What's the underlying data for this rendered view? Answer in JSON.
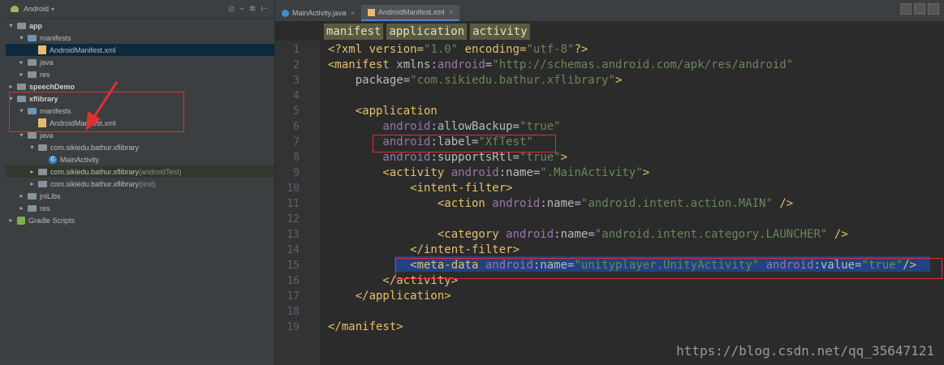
{
  "project": {
    "title": "Android",
    "tree": [
      {
        "label": "app",
        "indent": 0,
        "icon": "folder",
        "bold": true,
        "arrow": "▾"
      },
      {
        "label": "manifests",
        "indent": 1,
        "icon": "folder-blue",
        "arrow": "▾"
      },
      {
        "label": "AndroidManifest.xml",
        "indent": 2,
        "icon": "xml",
        "arrow": "",
        "state": "sel"
      },
      {
        "label": "java",
        "indent": 1,
        "icon": "folder",
        "arrow": "▸"
      },
      {
        "label": "res",
        "indent": 1,
        "icon": "folder",
        "arrow": "▸"
      },
      {
        "label": "speechDemo",
        "indent": 0,
        "icon": "folder",
        "bold": true,
        "arrow": "▸"
      },
      {
        "label": "xflibrary",
        "indent": 0,
        "icon": "folder",
        "bold": true,
        "arrow": "▾"
      },
      {
        "label": "manifests",
        "indent": 1,
        "icon": "folder-blue",
        "arrow": "▾"
      },
      {
        "label": "AndroidManifest.xml",
        "indent": 2,
        "icon": "xml",
        "arrow": ""
      },
      {
        "label": "java",
        "indent": 1,
        "icon": "folder",
        "arrow": "▾"
      },
      {
        "label": "com.sikiedu.bathur.xflibrary",
        "indent": 2,
        "icon": "pkg",
        "arrow": "▾"
      },
      {
        "label": "MainActivity",
        "indent": 3,
        "icon": "class",
        "arrow": ""
      },
      {
        "label": "com.sikiedu.bathur.xflibrary",
        "suffix": "(androidTest)",
        "indent": 2,
        "icon": "pkg",
        "arrow": "▸",
        "state": "hl"
      },
      {
        "label": "com.sikiedu.bathur.xflibrary",
        "suffix": "(test)",
        "indent": 2,
        "icon": "pkg",
        "arrow": "▸"
      },
      {
        "label": "jniLibs",
        "indent": 1,
        "icon": "folder",
        "arrow": "▸"
      },
      {
        "label": "res",
        "indent": 1,
        "icon": "folder",
        "arrow": "▸"
      },
      {
        "label": "Gradle Scripts",
        "indent": 0,
        "icon": "gradle",
        "arrow": "▸"
      }
    ]
  },
  "tabs": [
    {
      "label": "MainActivity.java",
      "active": false
    },
    {
      "label": "AndroidManifest.xml",
      "active": true
    }
  ],
  "breadcrumbs": [
    "manifest",
    "application",
    "activity"
  ],
  "code": [
    [
      [
        "tag",
        "<?xml version="
      ],
      [
        "str",
        "\"1.0\""
      ],
      [
        "tag",
        " encoding="
      ],
      [
        "str",
        "\"utf-8\""
      ],
      [
        "tag",
        "?>"
      ]
    ],
    [
      [
        "tag",
        "<manifest "
      ],
      [
        "attr",
        "xmlns"
      ],
      [
        "plain",
        ":"
      ],
      [
        "ns",
        "android"
      ],
      [
        "plain",
        "="
      ],
      [
        "str",
        "\"http://schemas.android.com/apk/res/android\""
      ]
    ],
    [
      [
        "attr",
        "    package"
      ],
      [
        "plain",
        "="
      ],
      [
        "str",
        "\"com.sikiedu.bathur.xflibrary\""
      ],
      [
        "tag",
        ">"
      ]
    ],
    [],
    [
      [
        "tag",
        "    <application"
      ]
    ],
    [
      [
        "ns",
        "        android"
      ],
      [
        "attr",
        ":allowBackup"
      ],
      [
        "plain",
        "="
      ],
      [
        "str",
        "\"true\""
      ]
    ],
    [
      [
        "ns",
        "        android"
      ],
      [
        "attr",
        ":label"
      ],
      [
        "plain",
        "="
      ],
      [
        "str",
        "\"XfTest\""
      ]
    ],
    [
      [
        "ns",
        "        android"
      ],
      [
        "attr",
        ":supportsRtl"
      ],
      [
        "plain",
        "="
      ],
      [
        "str",
        "\"true\""
      ],
      [
        "tag",
        ">"
      ]
    ],
    [
      [
        "tag",
        "        <activity "
      ],
      [
        "ns",
        "android"
      ],
      [
        "attr",
        ":name"
      ],
      [
        "plain",
        "="
      ],
      [
        "str",
        "\".MainActivity\""
      ],
      [
        "tag",
        ">"
      ]
    ],
    [
      [
        "tag",
        "            <intent-filter>"
      ]
    ],
    [
      [
        "tag",
        "                <action "
      ],
      [
        "ns",
        "android"
      ],
      [
        "attr",
        ":name"
      ],
      [
        "plain",
        "="
      ],
      [
        "str",
        "\"android.intent.action.MAIN\""
      ],
      [
        "tag",
        " />"
      ]
    ],
    [],
    [
      [
        "tag",
        "                <category "
      ],
      [
        "ns",
        "android"
      ],
      [
        "attr",
        ":name"
      ],
      [
        "plain",
        "="
      ],
      [
        "str",
        "\"android.intent.category.LAUNCHER\""
      ],
      [
        "tag",
        " />"
      ]
    ],
    [
      [
        "tag",
        "            </intent-filter>"
      ]
    ],
    [
      [
        "tag",
        "            <meta-data "
      ],
      [
        "ns",
        "android"
      ],
      [
        "attr",
        ":name"
      ],
      [
        "plain",
        "="
      ],
      [
        "str",
        "\"unityplayer.UnityActivity\""
      ],
      [
        "plain",
        " "
      ],
      [
        "ns",
        "android"
      ],
      [
        "attr",
        ":value"
      ],
      [
        "plain",
        "="
      ],
      [
        "str",
        "\"true\""
      ],
      [
        "tag",
        "/>"
      ]
    ],
    [
      [
        "tag",
        "        </activity>"
      ]
    ],
    [
      [
        "tag",
        "    </application>"
      ]
    ],
    [],
    [
      [
        "tag",
        "</manifest>"
      ]
    ]
  ],
  "watermark": "https://blog.csdn.net/qq_35647121"
}
